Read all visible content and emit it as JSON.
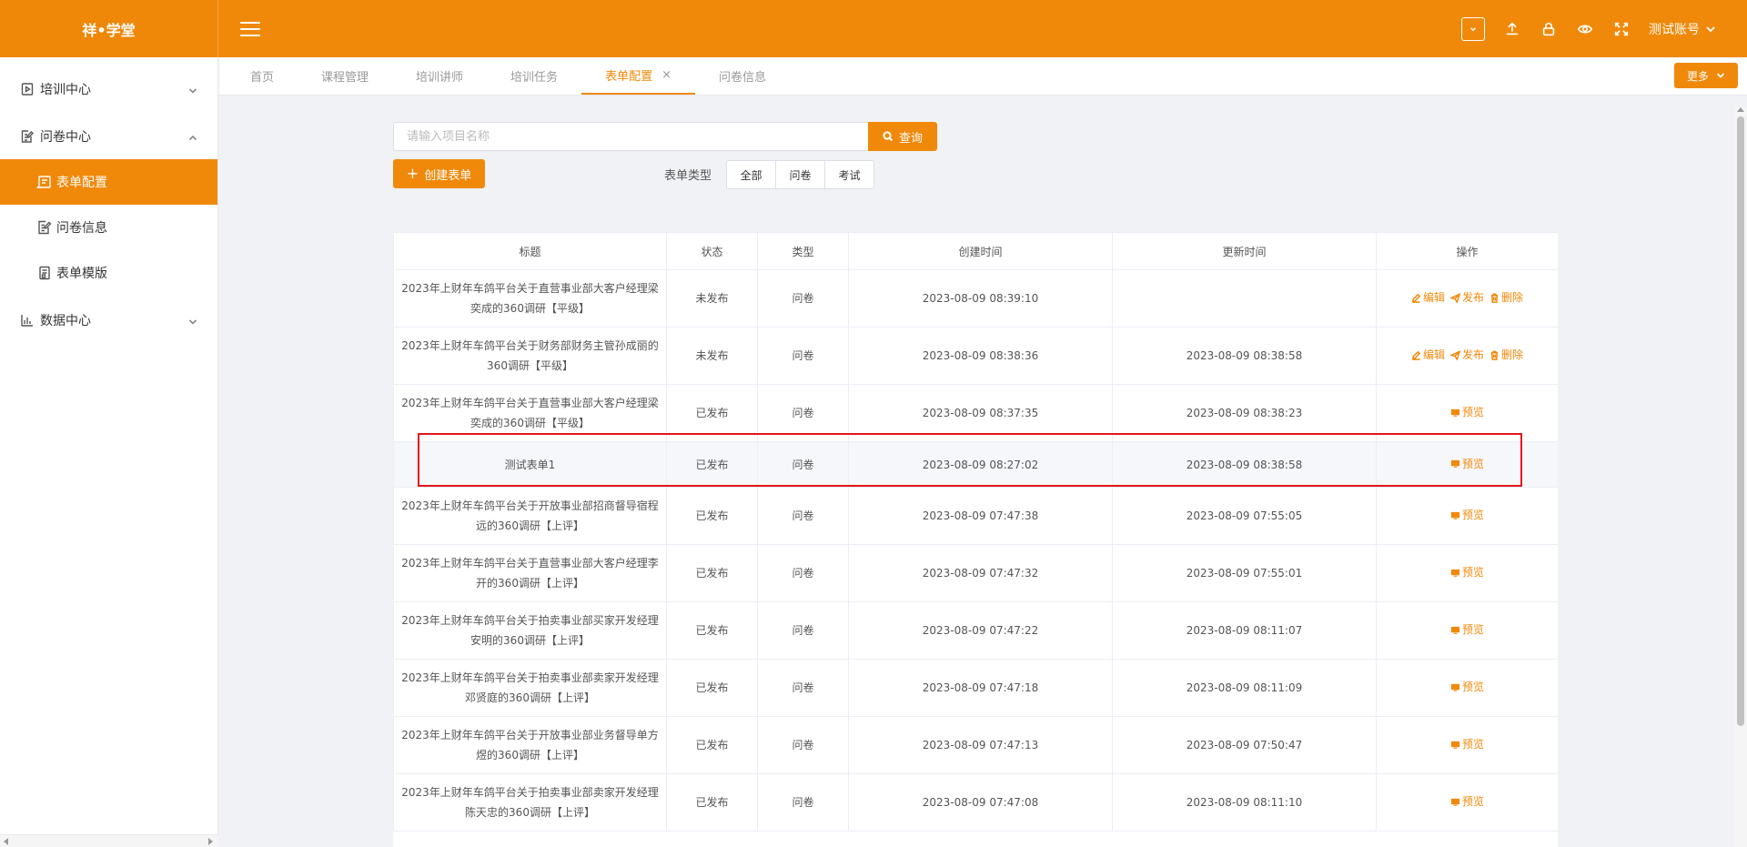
{
  "app": {
    "logo": "祥•学堂",
    "account": "测试账号"
  },
  "sidebar": {
    "items": [
      {
        "label": "培训中心",
        "expanded": false
      },
      {
        "label": "问卷中心",
        "expanded": true,
        "children": [
          {
            "label": "表单配置",
            "active": true
          },
          {
            "label": "问卷信息",
            "active": false
          },
          {
            "label": "表单模版",
            "active": false
          }
        ]
      },
      {
        "label": "数据中心",
        "expanded": false
      }
    ]
  },
  "tabs": [
    {
      "label": "首页"
    },
    {
      "label": "课程管理"
    },
    {
      "label": "培训讲师"
    },
    {
      "label": "培训任务"
    },
    {
      "label": "表单配置",
      "active": true,
      "closable": true
    },
    {
      "label": "问卷信息"
    }
  ],
  "more_label": "更多",
  "search": {
    "placeholder": "请输入项目名称",
    "value": "",
    "button": "查询"
  },
  "create_label": "创建表单",
  "type_filter": {
    "label": "表单类型",
    "options": [
      "全部",
      "问卷",
      "考试"
    ]
  },
  "table": {
    "headers": [
      "标题",
      "状态",
      "类型",
      "创建时间",
      "更新时间",
      "操作"
    ],
    "op_labels": {
      "edit": "编辑",
      "publish": "发布",
      "delete": "删除",
      "preview": "预览"
    },
    "rows": [
      {
        "title": "2023年上财年车鸽平台关于直营事业部大客户经理梁奕成的360调研【平级】",
        "status": "未发布",
        "type": "问卷",
        "created": "2023-08-09 08:39:10",
        "updated": "",
        "ops": [
          "edit",
          "publish",
          "delete"
        ]
      },
      {
        "title": "2023年上财年车鸽平台关于财务部财务主管孙成丽的360调研【平级】",
        "status": "未发布",
        "type": "问卷",
        "created": "2023-08-09 08:38:36",
        "updated": "2023-08-09 08:38:58",
        "ops": [
          "edit",
          "publish",
          "delete"
        ]
      },
      {
        "title": "2023年上财年车鸽平台关于直营事业部大客户经理梁奕成的360调研【平级】",
        "status": "已发布",
        "type": "问卷",
        "created": "2023-08-09 08:37:35",
        "updated": "2023-08-09 08:38:23",
        "ops": [
          "preview"
        ]
      },
      {
        "title": "测试表单1",
        "status": "已发布",
        "type": "问卷",
        "created": "2023-08-09 08:27:02",
        "updated": "2023-08-09 08:38:58",
        "ops": [
          "preview"
        ],
        "highlight": true
      },
      {
        "title": "2023年上财年车鸽平台关于开放事业部招商督导宿程远的360调研【上评】",
        "status": "已发布",
        "type": "问卷",
        "created": "2023-08-09 07:47:38",
        "updated": "2023-08-09 07:55:05",
        "ops": [
          "preview"
        ]
      },
      {
        "title": "2023年上财年车鸽平台关于直营事业部大客户经理李开的360调研【上评】",
        "status": "已发布",
        "type": "问卷",
        "created": "2023-08-09 07:47:32",
        "updated": "2023-08-09 07:55:01",
        "ops": [
          "preview"
        ]
      },
      {
        "title": "2023年上财年车鸽平台关于拍卖事业部买家开发经理安明的360调研【上评】",
        "status": "已发布",
        "type": "问卷",
        "created": "2023-08-09 07:47:22",
        "updated": "2023-08-09 08:11:07",
        "ops": [
          "preview"
        ]
      },
      {
        "title": "2023年上财年车鸽平台关于拍卖事业部卖家开发经理邓贤庭的360调研【上评】",
        "status": "已发布",
        "type": "问卷",
        "created": "2023-08-09 07:47:18",
        "updated": "2023-08-09 08:11:09",
        "ops": [
          "preview"
        ]
      },
      {
        "title": "2023年上财年车鸽平台关于开放事业部业务督导单方煜的360调研【上评】",
        "status": "已发布",
        "type": "问卷",
        "created": "2023-08-09 07:47:13",
        "updated": "2023-08-09 07:50:47",
        "ops": [
          "preview"
        ]
      },
      {
        "title": "2023年上财年车鸽平台关于拍卖事业部卖家开发经理陈天忠的360调研【上评】",
        "status": "已发布",
        "type": "问卷",
        "created": "2023-08-09 07:47:08",
        "updated": "2023-08-09 08:11:10",
        "ops": [
          "preview"
        ]
      }
    ]
  },
  "colors": {
    "accent": "#f0890a",
    "highlight_border": "#e3161b"
  }
}
